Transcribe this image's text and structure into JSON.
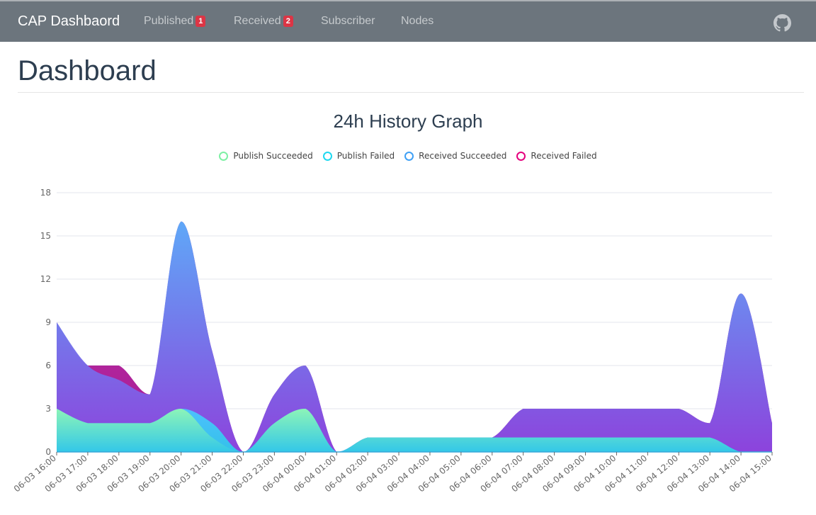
{
  "navbar": {
    "brand": "CAP Dashbaord",
    "items": [
      {
        "label": "Published",
        "badge": "1"
      },
      {
        "label": "Received",
        "badge": "2"
      },
      {
        "label": "Subscriber"
      },
      {
        "label": "Nodes"
      }
    ],
    "github_icon": "github-icon"
  },
  "page": {
    "title": "Dashboard"
  },
  "chart_data": {
    "type": "area",
    "title": "24h History Graph",
    "xlabel": "",
    "ylabel": "",
    "ylim": [
      0,
      18
    ],
    "yticks": [
      0,
      3,
      6,
      9,
      12,
      15,
      18
    ],
    "grid": true,
    "legend_position": "top-center",
    "categories": [
      "06-03 16:00",
      "06-03 17:00",
      "06-03 18:00",
      "06-03 19:00",
      "06-03 20:00",
      "06-03 21:00",
      "06-03 22:00",
      "06-03 23:00",
      "06-04 00:00",
      "06-04 01:00",
      "06-04 02:00",
      "06-04 03:00",
      "06-04 04:00",
      "06-04 05:00",
      "06-04 06:00",
      "06-04 07:00",
      "06-04 08:00",
      "06-04 09:00",
      "06-04 10:00",
      "06-04 11:00",
      "06-04 12:00",
      "06-04 13:00",
      "06-04 14:00",
      "06-04 15:00"
    ],
    "series": [
      {
        "name": "Received Failed",
        "color": "#e5007e",
        "gradient": [
          "#c026a0",
          "#a01090"
        ],
        "values": [
          9,
          6,
          6,
          4,
          16,
          7,
          0,
          4,
          6,
          0,
          1,
          1,
          1,
          1,
          1,
          3,
          3,
          3,
          3,
          3,
          3,
          2,
          11,
          2
        ]
      },
      {
        "name": "Received Succeeded",
        "color": "#3fa0f5",
        "gradient": [
          "#5aaefc",
          "#8b45e0"
        ],
        "values": [
          9,
          6,
          5,
          4,
          16,
          7,
          0,
          4,
          6,
          0,
          1,
          1,
          1,
          1,
          1,
          3,
          3,
          3,
          3,
          3,
          3,
          2,
          11,
          2
        ]
      },
      {
        "name": "Publish Failed",
        "color": "#1ed8f0",
        "gradient": [
          "#4ac6ff",
          "#2fc8ea"
        ],
        "values": [
          3,
          2,
          2,
          2,
          3,
          2,
          0,
          2,
          3,
          0,
          1,
          1,
          1,
          1,
          1,
          1,
          1,
          1,
          1,
          1,
          1,
          1,
          0,
          0
        ]
      },
      {
        "name": "Publish Succeeded",
        "color": "#7ef0a4",
        "gradient": [
          "#90f7b4",
          "#33c8e8"
        ],
        "values": [
          3,
          2,
          2,
          2,
          3,
          1,
          0,
          2,
          3,
          0,
          1,
          1,
          1,
          1,
          1,
          1,
          1,
          1,
          1,
          1,
          1,
          1,
          0,
          0
        ]
      }
    ]
  }
}
